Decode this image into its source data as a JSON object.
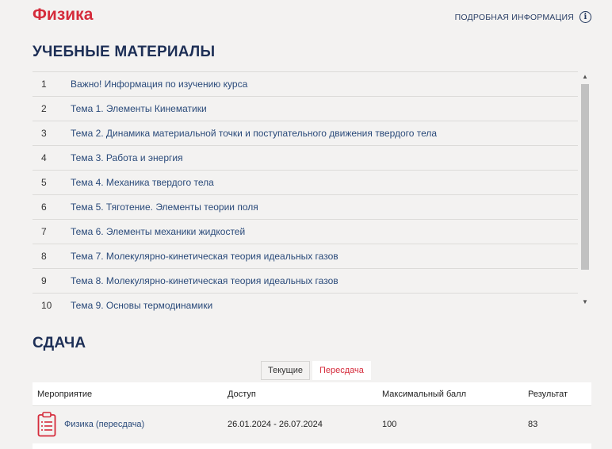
{
  "course": {
    "title": "Физика"
  },
  "header": {
    "info_label": "ПОДРОБНАЯ ИНФОРМАЦИЯ",
    "info_icon": "info-icon"
  },
  "materials": {
    "title": "УЧЕБНЫЕ МАТЕРИАЛЫ",
    "items": [
      {
        "num": "1",
        "label": "Важно! Информация по изучению курса"
      },
      {
        "num": "2",
        "label": "Тема 1. Элементы Кинематики"
      },
      {
        "num": "3",
        "label": "Тема 2. Динамика материальной точки и поступательного движения твердого тела"
      },
      {
        "num": "4",
        "label": "Тема 3. Работа и энергия"
      },
      {
        "num": "5",
        "label": "Тема 4. Механика твердого тела"
      },
      {
        "num": "6",
        "label": "Тема 5. Тяготение. Элементы теории поля"
      },
      {
        "num": "7",
        "label": "Тема 6. Элементы механики жидкостей"
      },
      {
        "num": "8",
        "label": "Тема 7. Молекулярно-кинетическая теория идеальных газов"
      },
      {
        "num": "9",
        "label": "Тема 8. Молекулярно-кинетическая теория идеальных газов"
      },
      {
        "num": "10",
        "label": "Тема 9. Основы термодинамики"
      }
    ]
  },
  "submission": {
    "title": "СДАЧА",
    "tabs": [
      {
        "label": "Текущие",
        "active": false
      },
      {
        "label": "Пересдача",
        "active": true
      }
    ],
    "columns": [
      "Мероприятие",
      "Доступ",
      "Максимальный балл",
      "Результат"
    ],
    "rows": [
      {
        "event": "Физика (пересдача)",
        "access": "26.01.2024 - 26.07.2024",
        "max_score": "100",
        "result": "83",
        "icon": "clipboard-icon"
      }
    ]
  },
  "colors": {
    "accent": "#d52b3b",
    "heading": "#1d2f56",
    "link": "#2a4a7a",
    "background": "#f3f2f1"
  }
}
